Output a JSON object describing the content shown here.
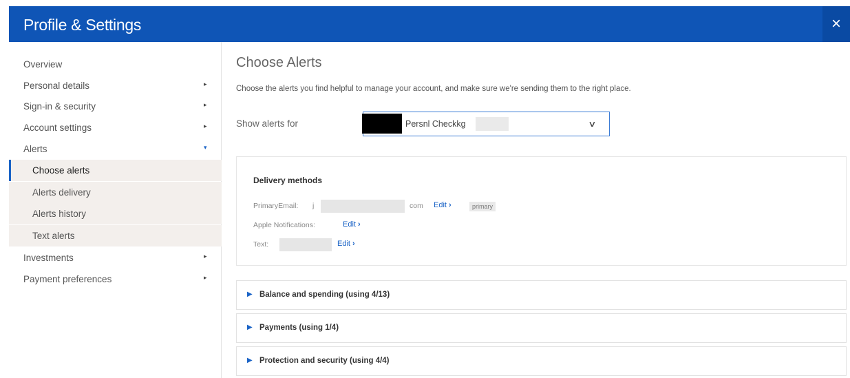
{
  "header": {
    "title": "Profile & Settings",
    "close_icon": "×"
  },
  "sidebar": {
    "items": [
      {
        "label": "Overview",
        "has_arrow": false
      },
      {
        "label": "Personal details",
        "arrow": "▸"
      },
      {
        "label": "Sign-in & security",
        "arrow": "▸"
      },
      {
        "label": "Account settings",
        "arrow": "▸"
      },
      {
        "label": "Alerts",
        "arrow": "▾",
        "expanded": true
      },
      {
        "label": "Investments",
        "arrow": "▸"
      },
      {
        "label": "Payment preferences",
        "arrow": "▸"
      }
    ],
    "alerts_sub": [
      {
        "label": "Choose alerts",
        "active": true
      },
      {
        "label": "Alerts delivery"
      },
      {
        "label": "Alerts history"
      },
      {
        "label": "Text alerts"
      }
    ]
  },
  "main": {
    "title": "Choose Alerts",
    "intro": "Choose the alerts you find helpful to manage your account, and make sure we're sending them to the right place.",
    "show_alerts_label": "Show alerts for",
    "account_select": {
      "value": "Persnl Checkkg",
      "chevron": "∨"
    },
    "delivery": {
      "title": "Delivery methods",
      "primary_email_label": "PrimaryEmail:",
      "primary_email_start": "j",
      "primary_email_end": "com",
      "primary_badge": "primary",
      "apple_label": "Apple Notifications:",
      "text_label": "Text:",
      "edit_label": "Edit",
      "edit_chevron": "›"
    },
    "sections": [
      {
        "label": "Balance and spending (using 4/13)"
      },
      {
        "label": "Payments (using 1/4)"
      },
      {
        "label": "Protection and security (using 4/4)"
      }
    ],
    "section_icon": "▶"
  },
  "colors": {
    "header_blue": "#0f55b6",
    "link_blue": "#1a63c6",
    "submenu_bg": "#f3efec"
  }
}
